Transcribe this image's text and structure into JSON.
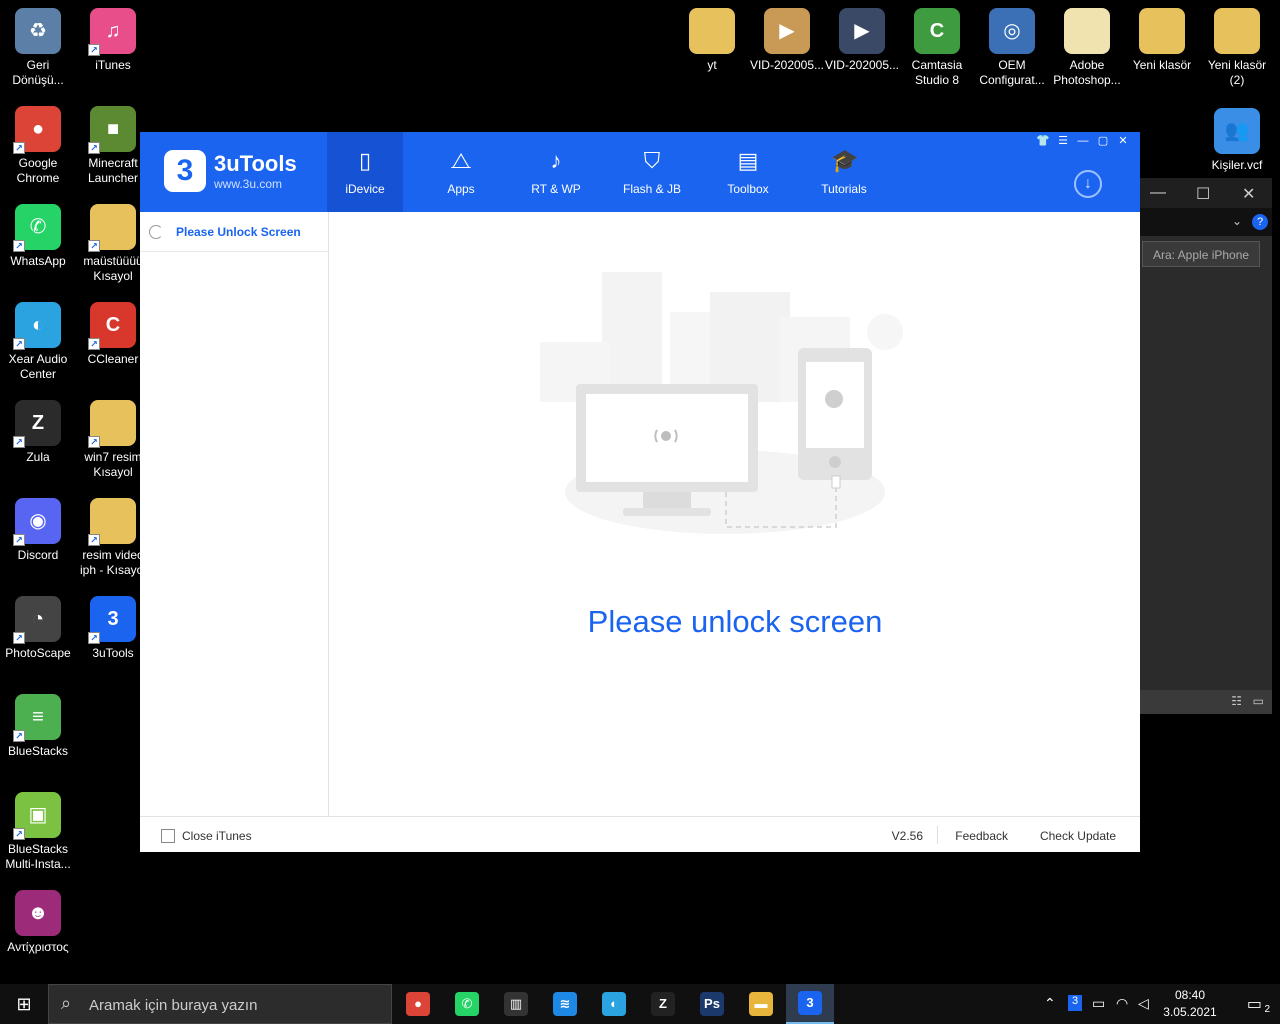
{
  "desktop": {
    "left_icons": [
      {
        "label": "Geri Dönüşü...",
        "glyph": "♻",
        "color": "#5b7fa6",
        "icon": "recycle-bin-icon",
        "shortcut": false
      },
      {
        "label": "iTunes",
        "glyph": "♫",
        "color": "#e84f8a",
        "icon": "itunes-icon",
        "shortcut": true
      },
      {
        "label": "Google Chrome",
        "glyph": "●",
        "color": "#db4437",
        "icon": "chrome-icon",
        "shortcut": true
      },
      {
        "label": "Minecraft Launcher",
        "glyph": "■",
        "color": "#5b8a32",
        "icon": "minecraft-icon",
        "shortcut": true
      },
      {
        "label": "WhatsApp",
        "glyph": "✆",
        "color": "#25d366",
        "icon": "whatsapp-icon",
        "shortcut": true
      },
      {
        "label": "maüstüüüü Kısayol",
        "glyph": "",
        "color": "#e7c25c",
        "icon": "folder-icon",
        "shortcut": true
      },
      {
        "label": "Xear Audio Center",
        "glyph": "◐",
        "color": "#2aa3e0",
        "icon": "xear-audio-icon",
        "shortcut": true
      },
      {
        "label": "CCleaner",
        "glyph": "C",
        "color": "#d8372b",
        "icon": "ccleaner-icon",
        "shortcut": true
      },
      {
        "label": "Zula",
        "glyph": "Z",
        "color": "#2b2b2b",
        "icon": "zula-icon",
        "shortcut": true
      },
      {
        "label": "win7 resim Kısayol",
        "glyph": "",
        "color": "#e7c25c",
        "icon": "folder-icon",
        "shortcut": true
      },
      {
        "label": "Discord",
        "glyph": "◉",
        "color": "#5865f2",
        "icon": "discord-icon",
        "shortcut": true
      },
      {
        "label": "resim video iph - Kısayol",
        "glyph": "",
        "color": "#e7c25c",
        "icon": "folder-icon",
        "shortcut": true
      },
      {
        "label": "PhotoScape",
        "glyph": "◔",
        "color": "#444444",
        "icon": "photoscape-icon",
        "shortcut": true
      },
      {
        "label": "3uTools",
        "glyph": "3",
        "color": "#1a64f0",
        "icon": "3utools-icon",
        "shortcut": true
      },
      {
        "label": "BlueStacks",
        "glyph": "≡",
        "color": "#4caf50",
        "icon": "bluestacks-icon",
        "shortcut": true
      },
      {
        "label": "BlueStacks Multi-Insta...",
        "glyph": "▣",
        "color": "#7cc242",
        "icon": "bluestacks-multi-icon",
        "shortcut": true
      },
      {
        "label": "Αντίχριστος",
        "glyph": "☻",
        "color": "#9c2b7a",
        "icon": "image-file-icon",
        "shortcut": false
      }
    ],
    "top_icons": [
      {
        "label": "yt",
        "glyph": "",
        "color": "#e7c25c",
        "icon": "folder-icon"
      },
      {
        "label": "VID-202005...",
        "glyph": "▶",
        "color": "#c89a55",
        "icon": "video-file-icon"
      },
      {
        "label": "VID-202005...",
        "glyph": "▶",
        "color": "#3a4a66",
        "icon": "video-file-icon"
      },
      {
        "label": "Camtasia Studio 8",
        "glyph": "C",
        "color": "#3f9b3f",
        "icon": "camtasia-icon"
      },
      {
        "label": "OEM Configurat...",
        "glyph": "◎",
        "color": "#3b6fb6",
        "icon": "oem-config-icon"
      },
      {
        "label": "Adobe Photoshop...",
        "glyph": "",
        "color": "#f1e3b0",
        "icon": "file-icon"
      },
      {
        "label": "Yeni klasör",
        "glyph": "",
        "color": "#e7c25c",
        "icon": "folder-icon"
      },
      {
        "label": "Yeni klasör (2)",
        "glyph": "",
        "color": "#e7c25c",
        "icon": "folder-icon"
      }
    ],
    "contacts_icon": {
      "label": "Kişiler.vcf",
      "glyph": "👥",
      "color": "#3a8ee6",
      "icon": "contacts-file-icon"
    }
  },
  "bg_window": {
    "search_placeholder": "Ara: Apple iPhone"
  },
  "app": {
    "brand_name": "3uTools",
    "brand_url": "www.3u.com",
    "logo_glyph": "3",
    "nav": [
      {
        "label": "iDevice",
        "glyph": "▯",
        "icon": "phone-icon",
        "active": true
      },
      {
        "label": "Apps",
        "glyph": "⧍",
        "icon": "app-store-icon",
        "active": false
      },
      {
        "label": "RT & WP",
        "glyph": "♪",
        "icon": "ringtone-icon",
        "active": false
      },
      {
        "label": "Flash & JB",
        "glyph": "⛉",
        "icon": "shield-icon",
        "active": false
      },
      {
        "label": "Toolbox",
        "glyph": "▤",
        "icon": "toolbox-icon",
        "active": false
      },
      {
        "label": "Tutorials",
        "glyph": "🎓",
        "icon": "graduation-cap-icon",
        "active": false
      }
    ],
    "window_controls": [
      "👕",
      "☰",
      "—",
      "▢",
      "✕"
    ],
    "download_glyph": "↓",
    "sidebar_label": "Please Unlock Screen",
    "main_message": "Please unlock screen",
    "footer": {
      "close_itunes": "Close iTunes",
      "version": "V2.56",
      "feedback": "Feedback",
      "check_update": "Check Update"
    }
  },
  "taskbar": {
    "search_placeholder": "Aramak için buraya yazın",
    "apps": [
      {
        "glyph": "●",
        "color": "#db4437",
        "icon": "chrome-icon",
        "active": false
      },
      {
        "glyph": "✆",
        "color": "#25d366",
        "icon": "whatsapp-icon",
        "active": false
      },
      {
        "glyph": "▥",
        "color": "#333333",
        "icon": "audio-meter-icon",
        "active": false
      },
      {
        "glyph": "≋",
        "color": "#1e88e5",
        "icon": "waves-icon",
        "active": false
      },
      {
        "glyph": "◐",
        "color": "#2aa3e0",
        "icon": "xear-audio-icon",
        "active": false
      },
      {
        "glyph": "Z",
        "color": "#222222",
        "icon": "zula-icon",
        "active": false
      },
      {
        "glyph": "Ps",
        "color": "#1b3a6b",
        "icon": "photoshop-icon",
        "active": false
      },
      {
        "glyph": "▬",
        "color": "#e7b53c",
        "icon": "file-explorer-icon",
        "active": false
      },
      {
        "glyph": "3",
        "color": "#1a64f0",
        "icon": "3utools-icon",
        "active": true
      }
    ],
    "clock_time": "08:40",
    "clock_date": "3.05.2021",
    "notification_count": "2"
  }
}
